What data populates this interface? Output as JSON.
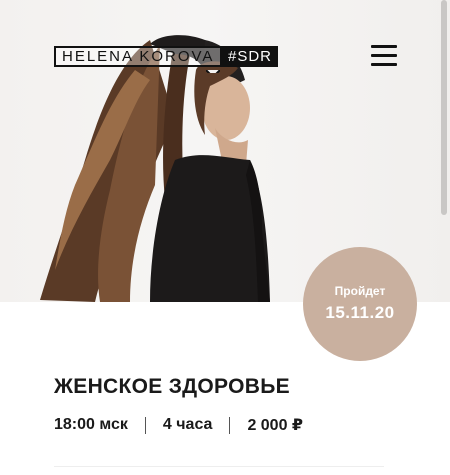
{
  "header": {
    "logo_name": "HELENA KOROVA",
    "logo_tag": "#SDR",
    "menu_icon": "hamburger-menu-icon"
  },
  "hero": {
    "image": "woman-with-long-hair-photo"
  },
  "event": {
    "date_label": "Пройдет",
    "date_value": "15.11.20",
    "title": "ЖЕНСКОЕ ЗДОРОВЬЕ",
    "time": "18:00 мск",
    "duration": "4 часа",
    "price": "2 000 ₽"
  },
  "colors": {
    "badge": "#c9b09f",
    "text": "#1a1a1a",
    "logo": "#111111"
  }
}
